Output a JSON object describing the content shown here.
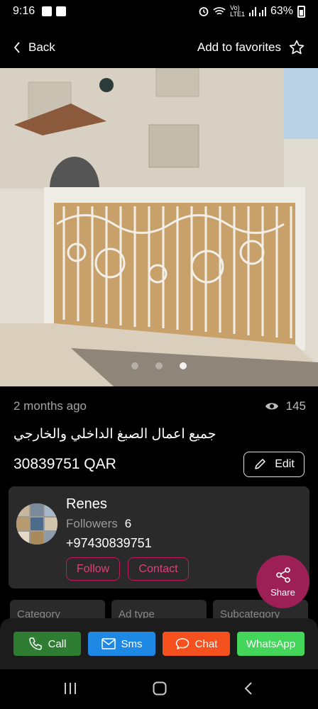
{
  "status_bar": {
    "time": "9:16",
    "battery": "63%"
  },
  "header": {
    "back_label": "Back",
    "favorites_label": "Add to favorites"
  },
  "gallery": {
    "image_count": 3,
    "active_index": 2
  },
  "listing": {
    "posted": "2 months ago",
    "views": "145",
    "title": "جميع اعمال الصبغ الداخلي والخارجي",
    "price": "30839751 QAR",
    "edit_label": "Edit"
  },
  "seller": {
    "name": "Renes",
    "followers_label": "Followers",
    "followers_count": "6",
    "phone": "+97430839751",
    "follow_label": "Follow",
    "contact_label": "Contact"
  },
  "share_label": "Share",
  "info_cards": [
    "Category",
    "Ad type",
    "Subcategory"
  ],
  "actions": {
    "call": "Call",
    "sms": "Sms",
    "chat": "Chat",
    "whatsapp": "WhatsApp"
  },
  "colors": {
    "accent": "#c2185b",
    "share_bg": "#9c1f55",
    "call": "#2e7d32",
    "sms": "#1e88e5",
    "chat": "#f4511e",
    "whatsapp": "#43d65a"
  }
}
